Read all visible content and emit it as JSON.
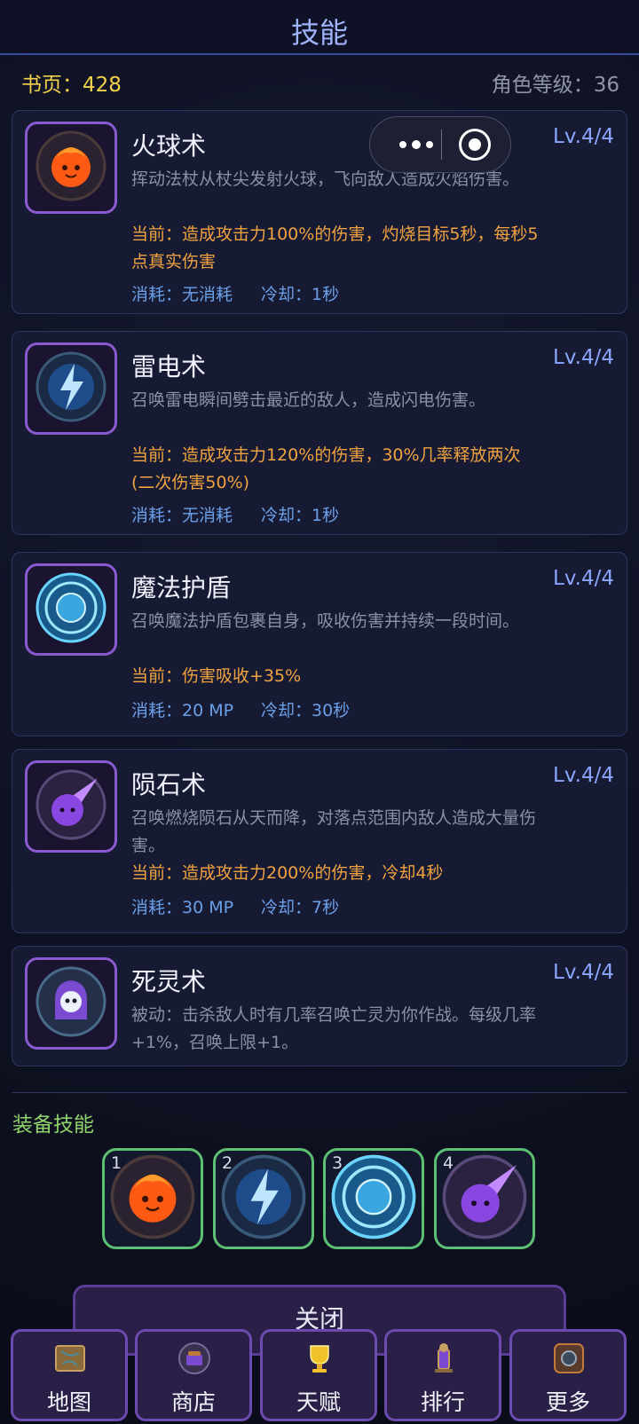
{
  "header": {
    "title": "技能"
  },
  "stats": {
    "pages": "书页：428",
    "char_level": "角色等级：36"
  },
  "skills": [
    {
      "name": "火球术",
      "level": "Lv.4/4",
      "icon": "fireball-icon",
      "color": "#ff6a1e",
      "desc": "挥动法杖从杖尖发射火球，飞向敌人造成火焰伤害。",
      "current": "当前：造成攻击力100%的伤害，灼烧目标5秒，每秒5点真实伤害",
      "cost": "消耗：无消耗",
      "cooldown": "冷却：1秒"
    },
    {
      "name": "雷电术",
      "level": "Lv.4/4",
      "icon": "lightning-icon",
      "color": "#3a8ee8",
      "desc": "召唤雷电瞬间劈击最近的敌人，造成闪电伤害。",
      "current": "当前：造成攻击力120%的伤害，30%几率释放两次(二次伤害50%)",
      "cost": "消耗：无消耗",
      "cooldown": "冷却：1秒"
    },
    {
      "name": "魔法护盾",
      "level": "Lv.4/4",
      "icon": "magic-shield-icon",
      "color": "#4ec6f0",
      "desc": "召唤魔法护盾包裹自身，吸收伤害并持续一段时间。",
      "current": "当前：伤害吸收+35%",
      "cost": "消耗：20 MP",
      "cooldown": "冷却：30秒"
    },
    {
      "name": "陨石术",
      "level": "Lv.4/4",
      "icon": "meteor-icon",
      "color": "#9c5ae6",
      "desc": "召唤燃烧陨石从天而降，对落点范围内敌人造成大量伤害。",
      "current": "当前：造成攻击力200%的伤害，冷却4秒",
      "cost": "消耗：30 MP",
      "cooldown": "冷却：7秒"
    },
    {
      "name": "死灵术",
      "level": "Lv.4/4",
      "icon": "necromancy-icon",
      "color": "#8a6ad8",
      "desc": "被动：击杀敌人时有几率召唤亡灵为你作战。每级几率+1%，召唤上限+1。"
    }
  ],
  "equipped": {
    "label": "装备技能",
    "slots": [
      {
        "num": "1",
        "icon": "fireball-icon"
      },
      {
        "num": "2",
        "icon": "lightning-icon"
      },
      {
        "num": "3",
        "icon": "magic-shield-icon"
      },
      {
        "num": "4",
        "icon": "meteor-icon"
      }
    ]
  },
  "close_label": "关闭",
  "nav": [
    {
      "label": "地图",
      "icon": "map-icon"
    },
    {
      "label": "商店",
      "icon": "shop-icon"
    },
    {
      "label": "天赋",
      "icon": "talent-trophy-icon"
    },
    {
      "label": "排行",
      "icon": "ranking-icon"
    },
    {
      "label": "更多",
      "icon": "more-icon"
    }
  ],
  "colors": {
    "accent": "#9fb3ff",
    "pages": "#f3d24a",
    "current": "#f0a340",
    "cost": "#6aa0e8",
    "equip_border": "#5cbf73",
    "card_border": "#8a5ad0"
  }
}
